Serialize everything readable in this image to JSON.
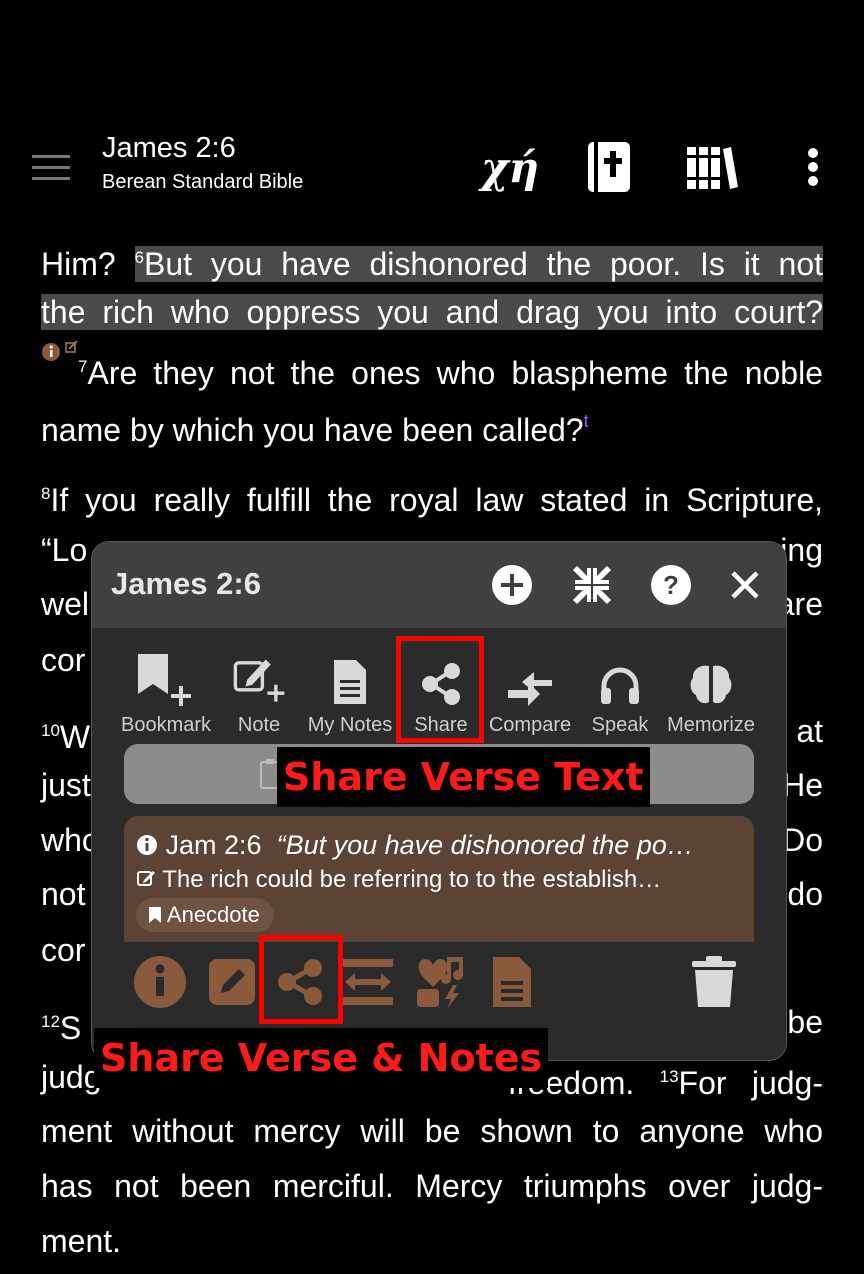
{
  "topbar": {
    "title": "James 2:6",
    "subtitle": "Berean Standard Bible",
    "greek_label": "χή"
  },
  "text": {
    "l1_pre": "Him? ",
    "v6": "6",
    "l1_hl": "But you have dishonored the poor. Is it not",
    "l2_hl": "the rich who oppress you and drag you into court?",
    "v7": "7",
    "l3": "Are they not the ones who blaspheme the noble",
    "l4": "name by which you have been called?",
    "xref_t": "t",
    "v8": "8",
    "l5": "If you really fulfill the royal law stated in Scripture,",
    "l6a": "“Lo",
    "l6b": "ing",
    "l7a": "wel",
    "l7b": "are",
    "l8a": "cor",
    "v10": "10",
    "l9a": "W",
    "l9b": "at",
    "l10a": "just",
    "l10b": "He",
    "l11a": "who",
    "l11b": "Do",
    "l12a": "not",
    "l12b": "do",
    "l13a": "cor",
    "v12": "12",
    "l14a": "S",
    "l14b": "be",
    "l15a": "judg",
    "l15b": "freedom.",
    "v13": "13",
    "l15c": "For judg-",
    "l16": "ment without mercy will be shown to anyone who",
    "l17": "has not been merciful. Mercy triumphs over judg-",
    "l18": "ment."
  },
  "popup": {
    "title": "James 2:6",
    "actions": [
      "Bookmark",
      "Note",
      "My Notes",
      "Share",
      "Compare",
      "Speak",
      "Memorize"
    ],
    "note": {
      "ref": "Jam 2:6",
      "quote": "“But you have dishonored the po…",
      "text": "The rich could be referring to to the establish…",
      "tag": "Anecdote"
    }
  },
  "annotations": {
    "share_verse_text": "Share Verse Text",
    "share_verse_notes": "Share Verse & Notes"
  },
  "colors": {
    "highlight": "#4a4a4a",
    "note_card": "#5b4336",
    "annotation_red": "#ff0000",
    "xref_purple": "#9b59ff"
  }
}
